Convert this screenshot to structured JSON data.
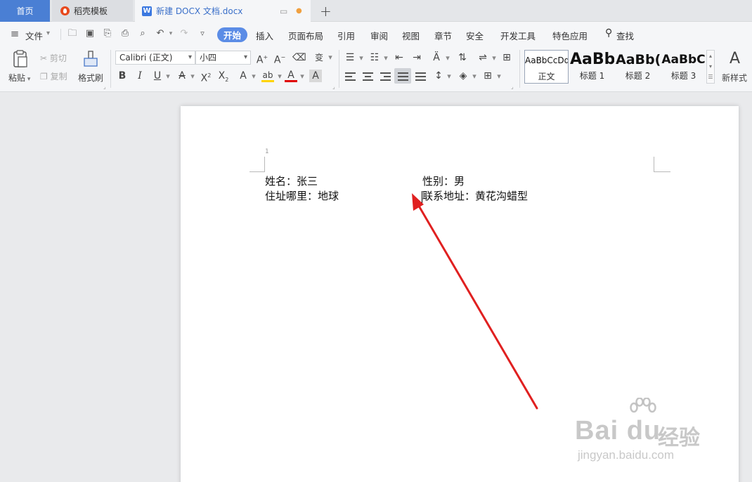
{
  "tabs": {
    "home": "首页",
    "docer": "稻壳模板",
    "doc": "新建 DOCX 文档.docx"
  },
  "menu": {
    "file": "文件",
    "items": [
      "开始",
      "插入",
      "页面布局",
      "引用",
      "审阅",
      "视图",
      "章节",
      "安全",
      "开发工具",
      "特色应用"
    ],
    "search": "查找"
  },
  "ribbon": {
    "paste": "粘贴",
    "cut": "剪切",
    "copy": "复制",
    "format_painter": "格式刷",
    "font_name": "Calibri (正文)",
    "font_size": "小四",
    "styles": [
      {
        "preview": "AaBbCcDd",
        "name": "正文"
      },
      {
        "preview": "AaBb",
        "name": "标题 1"
      },
      {
        "preview": "AaBb(",
        "name": "标题 2"
      },
      {
        "preview": "AaBbC",
        "name": "标题 3"
      }
    ],
    "new_style": "新样式"
  },
  "document": {
    "line_number": "1",
    "lines": [
      {
        "left": "姓名：张三",
        "right": "性别：男"
      },
      {
        "left": "住址哪里：地球",
        "right": "联系地址：黄花沟蜡型"
      }
    ]
  },
  "watermark": {
    "logo": "Bai du",
    "cn": "经验",
    "url": "jingyan.baidu.com"
  },
  "colors": {
    "accent": "#5b8ce6",
    "home_tab": "#4a7fd4",
    "arrow": "#e02020"
  }
}
